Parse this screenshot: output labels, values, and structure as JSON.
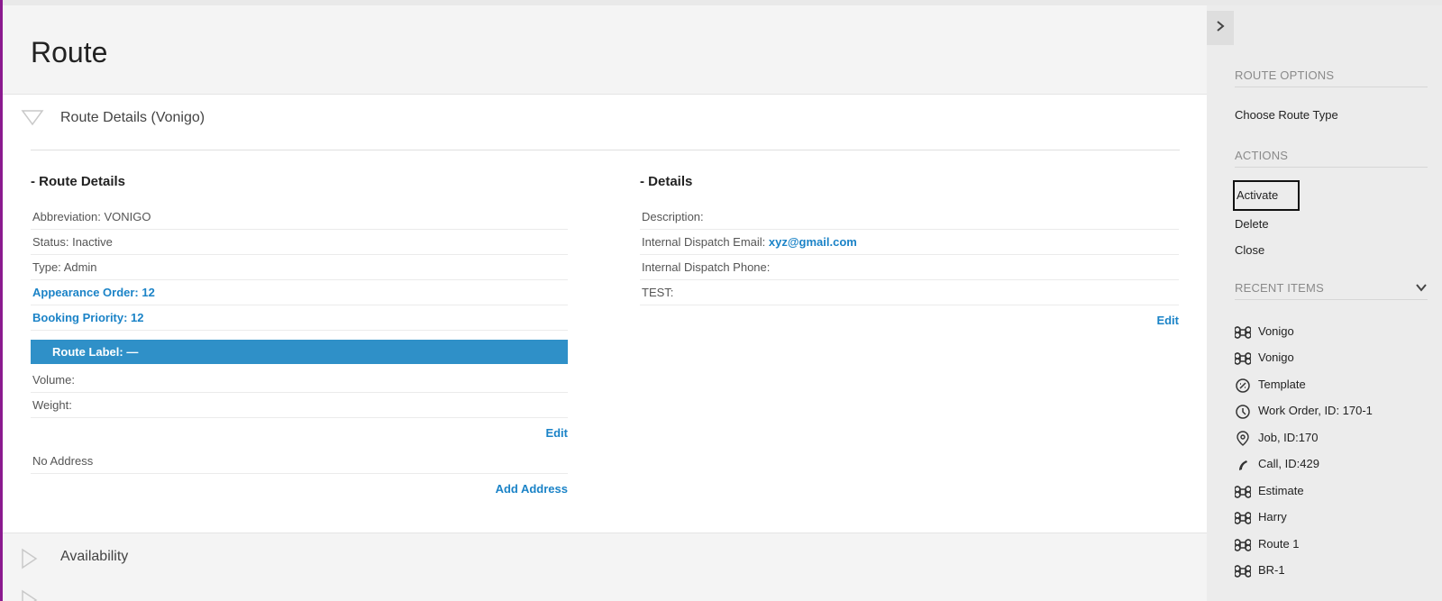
{
  "page": {
    "title": "Route"
  },
  "sections": {
    "details_header": "Route Details (Vonigo)",
    "availability_header": "Availability"
  },
  "route_details": {
    "title": "- Route Details",
    "abbreviation": "Abbreviation: VONIGO",
    "status": "Status: Inactive",
    "type": "Type: Admin",
    "appearance_order": "Appearance Order: 12",
    "booking_priority": "Booking Priority: 12",
    "route_label": "Route Label:  —",
    "volume": "Volume:",
    "weight": "Weight:",
    "edit": "Edit",
    "no_address": "No Address",
    "add_address": "Add Address"
  },
  "details": {
    "title": "- Details",
    "description": "Description:",
    "email_label": "Internal Dispatch Email: ",
    "email_value": "xyz@gmail.com",
    "phone": "Internal Dispatch Phone:",
    "test": "TEST:",
    "edit": "Edit"
  },
  "sidebar": {
    "collapse_icon": "chevron-right-icon",
    "route_options": {
      "heading": "ROUTE OPTIONS",
      "items": [
        "Choose Route Type"
      ]
    },
    "actions": {
      "heading": "ACTIONS",
      "items": [
        "Activate",
        "Delete",
        "Close"
      ]
    },
    "recent": {
      "heading": "RECENT ITEMS",
      "items": [
        {
          "label": "Vonigo",
          "icon": "command-icon"
        },
        {
          "label": "Vonigo",
          "icon": "command-icon"
        },
        {
          "label": "Template",
          "icon": "template-icon"
        },
        {
          "label": "Work Order, ID: 170-1",
          "icon": "clock-icon"
        },
        {
          "label": "Job, ID:170",
          "icon": "location-pin-icon"
        },
        {
          "label": "Call, ID:429",
          "icon": "phone-icon"
        },
        {
          "label": "Estimate",
          "icon": "command-icon"
        },
        {
          "label": "Harry",
          "icon": "command-icon"
        },
        {
          "label": "Route 1",
          "icon": "command-icon"
        },
        {
          "label": "BR-1",
          "icon": "command-icon"
        }
      ]
    }
  },
  "colors": {
    "accent": "#8b1a8f",
    "link": "#1b83c7",
    "label_bar": "#2f90c8"
  }
}
